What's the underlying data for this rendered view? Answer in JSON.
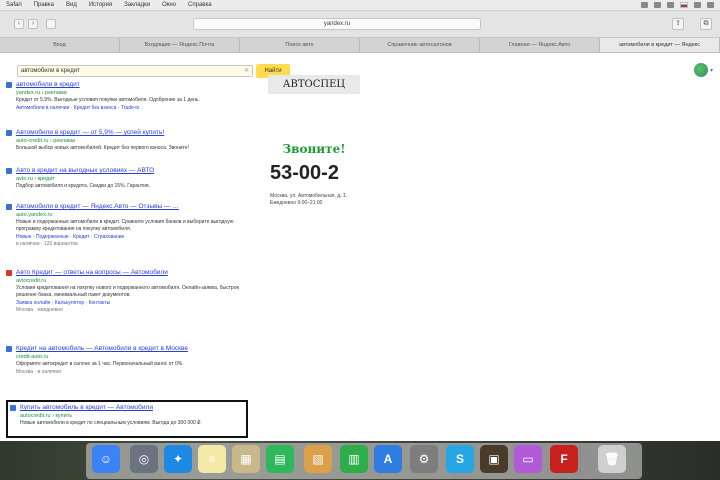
{
  "menubar": {
    "items": [
      "Safari",
      "Правка",
      "Вид",
      "История",
      "Закладки",
      "Окно",
      "Справка"
    ]
  },
  "toolbar": {
    "back": "‹",
    "forward": "›",
    "address": "yandex.ru",
    "share": "⇧",
    "tabs_overview": "⧉"
  },
  "tabs": [
    {
      "label": "Вход"
    },
    {
      "label": "Входящие — Яндекс.Почта"
    },
    {
      "label": "Поиск авто"
    },
    {
      "label": "Справочник автосалонов"
    },
    {
      "label": "Главная — Яндекс.Авто"
    },
    {
      "label": "автомобили в кредит — Яндекс"
    }
  ],
  "search": {
    "query": "автомобили в кредит",
    "button": "Найти"
  },
  "results": [
    {
      "title": "автомобили в кредит",
      "url": "yandex.ru › реклама",
      "snippet": "Кредит от 5,9%. Выгодные условия покупки автомобиля. Одобрение за 1 день.",
      "links": "Автомобили в наличии · Кредит без взноса · Trade-in"
    },
    {
      "title": "Автомобили в кредит — от 5,9% — успей купить!",
      "url": "auto-credit.ru › реклама",
      "snippet": "Большой выбор новых автомобилей. Кредит без первого взноса. Звоните!"
    },
    {
      "title": "Авто в кредит на выгодных условиях — АВТО",
      "url": "avto.ru › кредит",
      "snippet": "Подбор автомобиля и кредита. Скидки до 15%. Гарантия."
    },
    {
      "title": "Автомобили в кредит — Яндекс.Авто — Отзывы — …",
      "url": "auto.yandex.ru",
      "snippet": "Новые и подержанные автомобили в кредит. Сравните условия банков и выберите выгодную программу кредитования на покупку автомобиля.",
      "links": "Новые · Подержанные · Кредит · Страхование",
      "meta": "в наличии · 120 вариантов"
    },
    {
      "title": "Авто Кредит — ответы на вопросы — Автомобили",
      "url": "avtocredit.ru",
      "snippet": "Условия кредитования на покупку нового и подержанного автомобиля. Онлайн-заявка, быстрое решение банка, минимальный пакет документов.",
      "links": "Заявка онлайн · Калькулятор · Контакты",
      "meta": "Москва · ежедневно"
    },
    {
      "title": "Кредит на автомобиль — Автомобили в кредит в Москве",
      "url": "credit-auto.ru",
      "snippet": "Оформите автокредит в салоне за 1 час. Первоначальный взнос от 0%.",
      "meta": "Москва · в наличии"
    },
    {
      "title": "Купить автомобиль в кредит — Автомобили",
      "url": "autocredit.ru › купить",
      "snippet": "Новые автомобили в кредит по специальным условиям. Выгода до 300 000 ₽."
    }
  ],
  "ad": {
    "brand": "АВТОСПЕЦ",
    "slogan": "Звоните!",
    "phone": "53-00-2",
    "address": "Москва, ул. Автомобильная, д. 1. Ежедневно 9:00–21:00"
  },
  "dock": {
    "items": [
      {
        "name": "finder",
        "color": "#3b82f6",
        "glyph": "☺"
      },
      {
        "name": "launchpad",
        "color": "#6b7280",
        "glyph": "◎"
      },
      {
        "name": "safari",
        "color": "#1e88e5",
        "glyph": "✦"
      },
      {
        "name": "notes",
        "color": "#f5e9a8",
        "glyph": "≡"
      },
      {
        "name": "photos",
        "color": "#c8b88a",
        "glyph": "▦"
      },
      {
        "name": "messages",
        "color": "#2fb75c",
        "glyph": "▤"
      },
      {
        "name": "preview",
        "color": "#dba04a",
        "glyph": "▧"
      },
      {
        "name": "numbers",
        "color": "#2eae4a",
        "glyph": "▥"
      },
      {
        "name": "appstore",
        "color": "#2f7de1",
        "glyph": "A"
      },
      {
        "name": "settings",
        "color": "#7d7d7d",
        "glyph": "⚙"
      },
      {
        "name": "skype",
        "color": "#26a5e4",
        "glyph": "S"
      },
      {
        "name": "photobooth",
        "color": "#4a3a2a",
        "glyph": "▣"
      },
      {
        "name": "stickies",
        "color": "#b15ad8",
        "glyph": "▭"
      },
      {
        "name": "filezilla",
        "color": "#c81f1f",
        "glyph": "F"
      },
      {
        "name": "trash",
        "color": "#cfcfcf",
        "glyph": "🗑"
      }
    ]
  }
}
